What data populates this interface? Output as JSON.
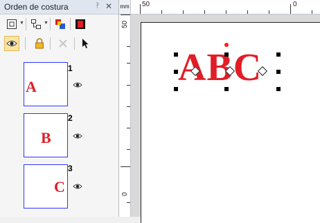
{
  "panel": {
    "title": "Orden de costura",
    "pin_glyph": "ᚹ",
    "close_glyph": "✕"
  },
  "toolbar": {
    "icons": [
      "view-icon",
      "sort-icon",
      "color-order-icon",
      "stop-color-icon",
      "eye-toggle-icon",
      "lock-icon",
      "cancel-icon",
      "pointer-icon"
    ]
  },
  "items": [
    {
      "number": "1",
      "letter": "A"
    },
    {
      "number": "2",
      "letter": "B"
    },
    {
      "number": "3",
      "letter": "C"
    }
  ],
  "ruler": {
    "unit": "mm",
    "top_labels": [
      "50",
      "0"
    ],
    "left_labels": [
      "50",
      "0"
    ]
  },
  "canvas": {
    "text": "ABC"
  },
  "colors": {
    "letter_red": "#e11d26",
    "thumb_border": "#2a36ff",
    "rotation_handle": "#ff1a1a"
  }
}
